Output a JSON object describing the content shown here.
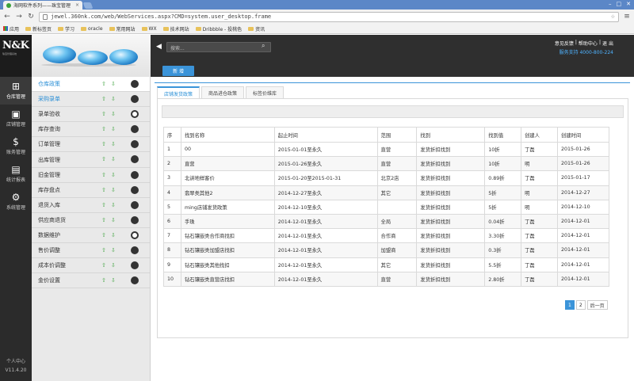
{
  "browser": {
    "tab_title": "海网软件系列——珠宝管理",
    "tab_close": "×",
    "new_tab": "",
    "url": "jewel.360nk.com/web/WebServices.aspx?CMD=system.user_desktop.frame",
    "bookmarks": [
      "应用",
      "新标签页",
      "学习",
      "oracle",
      "常用网站",
      "WX",
      "技术网站",
      "Dribbble - 投桃色",
      "资讯"
    ]
  },
  "header": {
    "logo": "N&K",
    "logo_sub": "珠宝管理系统",
    "search_placeholder": "搜索...",
    "top_links": [
      "意见反馈",
      "|",
      "帮助中心",
      "|",
      "退",
      "出"
    ],
    "service_line": "服务支持 4000-800-224"
  },
  "iconbar": {
    "items": [
      {
        "label": "仓库管理",
        "icon": "warehouse-icon",
        "glyph": "⊞"
      },
      {
        "label": "店铺管理",
        "icon": "shop-icon",
        "glyph": "▣"
      },
      {
        "label": "账务管理",
        "icon": "dollar-icon",
        "glyph": "$"
      },
      {
        "label": "统计报表",
        "icon": "report-icon",
        "glyph": "▤"
      },
      {
        "label": "系统管理",
        "icon": "settings-icon",
        "glyph": "⚙"
      }
    ],
    "user_center": "个人中心",
    "version": "V11.4.20"
  },
  "sidebar": {
    "items": [
      {
        "label": "仓库政策"
      },
      {
        "label": "采购录单"
      },
      {
        "label": "录单验收"
      },
      {
        "label": "库存查询"
      },
      {
        "label": "订单管理"
      },
      {
        "label": "出库管理"
      },
      {
        "label": "旧金管理"
      },
      {
        "label": "库存盘点"
      },
      {
        "label": "退货入库"
      },
      {
        "label": "供应商退货"
      },
      {
        "label": "数据维护"
      },
      {
        "label": "售价调整"
      },
      {
        "label": "成本价调整"
      },
      {
        "label": "金价设置"
      }
    ]
  },
  "toolbar": {
    "add_label": "新 增"
  },
  "tabs": [
    {
      "label": "店铺发货政策"
    },
    {
      "label": "商品进仓政策"
    },
    {
      "label": "标签价维库"
    }
  ],
  "table": {
    "columns": [
      "序",
      "找到名称",
      "起止时间",
      "范围",
      "找到",
      "找到值",
      "创建人",
      "创建时间"
    ],
    "rows": [
      [
        "1",
        "00",
        "2015-01-01至永久",
        "直营",
        "发货折扣找到",
        "10折",
        "丁磊",
        "2015-01-26"
      ],
      [
        "2",
        "直营",
        "2015-01-26至永久",
        "直营",
        "发货折扣找到",
        "10折",
        "明",
        "2015-01-26"
      ],
      [
        "3",
        "北讲地样客价",
        "2015-01-20至2015-01-31",
        "北京2店",
        "发货折扣找到",
        "0.89折",
        "丁磊",
        "2015-01-17"
      ],
      [
        "4",
        "翡翠类其他2",
        "2014-12-27至永久",
        "其它",
        "发货折扣找到",
        "5折",
        "明",
        "2014-12-27"
      ],
      [
        "5",
        "ming店铺发货政策",
        "2014-12-10至永久",
        "",
        "发货折扣找到",
        "5折",
        "明",
        "2014-12-10"
      ],
      [
        "6",
        "手珠",
        "2014-12-01至永久",
        "全局",
        "发货折扣找到",
        "0.04折",
        "丁磊",
        "2014-12-01"
      ],
      [
        "7",
        "钻石镶嵌类合作商找扣",
        "2014-12-01至永久",
        "合作商",
        "发货折扣找到",
        "3.30折",
        "丁磊",
        "2014-12-01"
      ],
      [
        "8",
        "钻石镶嵌类加盟店找扣",
        "2014-12-01至永久",
        "加盟商",
        "发货折扣找到",
        "0.3折",
        "丁磊",
        "2014-12-01"
      ],
      [
        "9",
        "钻石镶嵌类其他找扣",
        "2014-12-01至永久",
        "其它",
        "发货折扣找到",
        "5.5折",
        "丁磊",
        "2014-12-01"
      ],
      [
        "10",
        "钻石镶嵌类直营店找扣",
        "2014-12-01至永久",
        "直营",
        "发货折扣找到",
        "2.80折",
        "丁磊",
        "2014-12-01"
      ]
    ]
  },
  "pager": {
    "pages": [
      "1",
      "2"
    ],
    "next": "后一页"
  }
}
